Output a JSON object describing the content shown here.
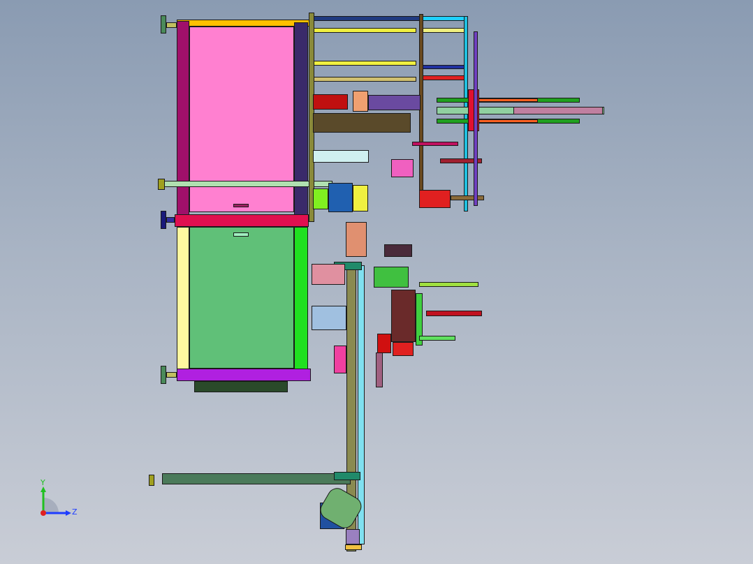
{
  "viewport": {
    "background_top": "#8a9bb2",
    "background_bottom": "#c9cdd6"
  },
  "triad": {
    "y_label": "Y",
    "z_label": "Z",
    "y_color": "#20c020",
    "z_color": "#1e3cff",
    "x_color": "#e02020"
  }
}
